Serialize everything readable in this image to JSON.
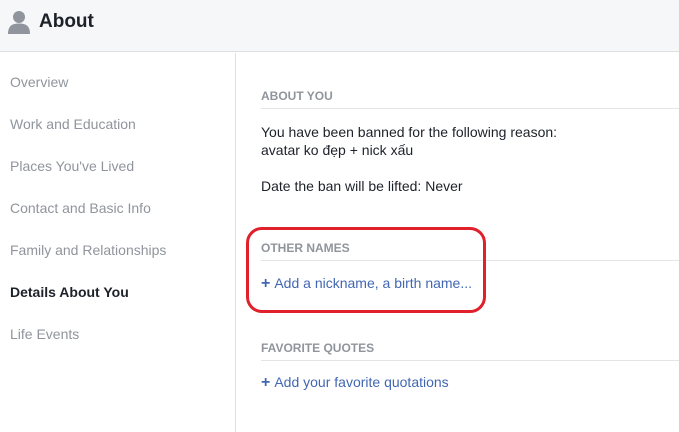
{
  "header": {
    "title": "About",
    "icon": "person-silhouette-icon"
  },
  "sidebar": {
    "items": [
      {
        "label": "Overview"
      },
      {
        "label": "Work and Education"
      },
      {
        "label": "Places You've Lived"
      },
      {
        "label": "Contact and Basic Info"
      },
      {
        "label": "Family and Relationships"
      },
      {
        "label": "Details About You",
        "active": true
      },
      {
        "label": "Life Events"
      }
    ]
  },
  "main": {
    "about_you": {
      "title": "ABOUT YOU",
      "line1": "You have been banned for the following reason:",
      "line2": "avatar ko đẹp + nick xấu",
      "line3": "Date the ban will be lifted: Never"
    },
    "other_names": {
      "title": "OTHER NAMES",
      "add_icon": "+",
      "add_label": "Add a nickname, a birth name..."
    },
    "favorite_quotes": {
      "title": "FAVORITE QUOTES",
      "add_icon": "+",
      "add_label": "Add your favorite quotations"
    }
  },
  "colors": {
    "link": "#4267b2",
    "muted": "#90949c",
    "highlight": "#e0202b",
    "header_bg": "#f6f7f9"
  }
}
